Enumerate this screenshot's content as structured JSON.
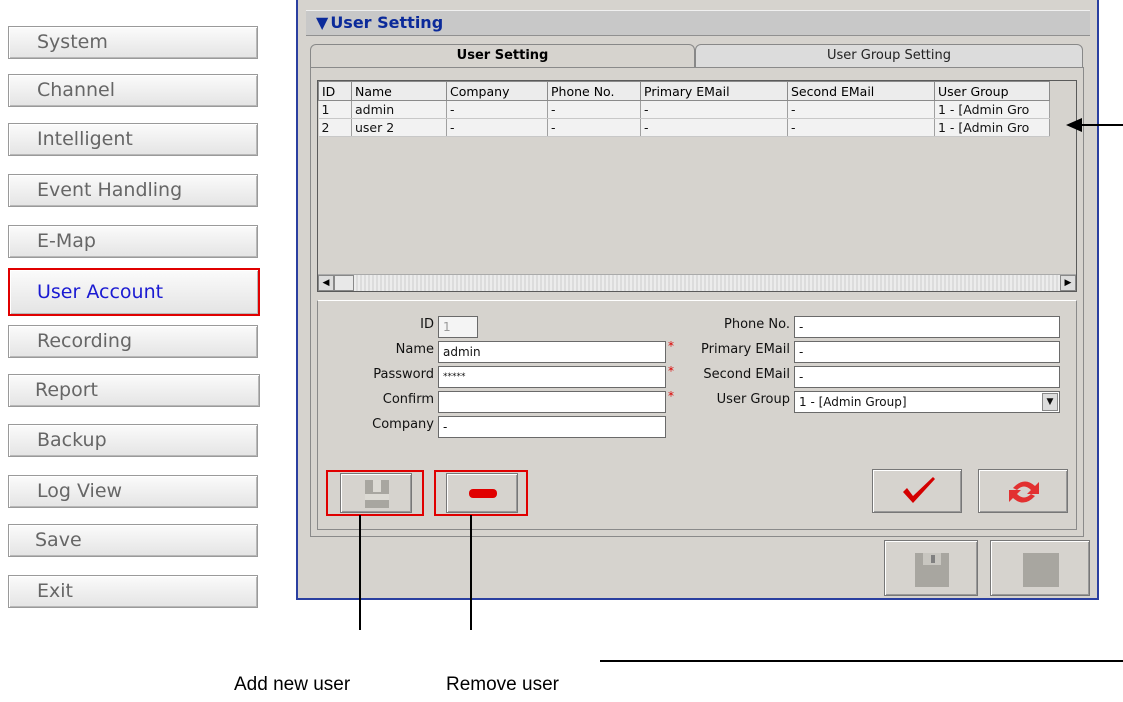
{
  "nav": {
    "items": [
      {
        "label": "System"
      },
      {
        "label": "Channel"
      },
      {
        "label": "Intelligent"
      },
      {
        "label": "Event Handling"
      },
      {
        "label": "E-Map"
      },
      {
        "label": "User Account"
      },
      {
        "label": "Recording"
      },
      {
        "label": "Report"
      },
      {
        "label": "Backup"
      },
      {
        "label": "Log View"
      },
      {
        "label": "Save"
      },
      {
        "label": "Exit"
      }
    ],
    "active": "User Account"
  },
  "window": {
    "title": "User Setting",
    "tabs": [
      "User Setting",
      "User Group Setting"
    ]
  },
  "grid": {
    "columns": [
      "ID",
      "Name",
      "Company",
      "Phone No.",
      "Primary EMail",
      "Second EMail",
      "User Group"
    ],
    "rows": [
      [
        "1",
        "admin",
        "-",
        "-",
        "-",
        "-",
        "1 - [Admin Gro"
      ],
      [
        "2",
        "user 2",
        "-",
        "-",
        "-",
        "-",
        "1 - [Admin Gro"
      ]
    ]
  },
  "form": {
    "id_label": "ID",
    "id_value": "1",
    "name_label": "Name",
    "name_value": "admin",
    "password_label": "Password",
    "password_value": "*****",
    "confirm_label": "Confirm",
    "confirm_value": "",
    "company_label": "Company",
    "company_value": "-",
    "phone_label": "Phone No.",
    "phone_value": "-",
    "primary_email_label": "Primary EMail",
    "primary_email_value": "-",
    "second_email_label": "Second EMail",
    "second_email_value": "-",
    "group_label": "User Group",
    "group_value": "1 - [Admin Group]",
    "required_mark": "*"
  },
  "captions": {
    "add": "Add new user",
    "remove": "Remove user"
  },
  "colors": {
    "highlight": "#e00000",
    "title_blue": "#0b2a9a",
    "ok_red": "#d40000"
  }
}
